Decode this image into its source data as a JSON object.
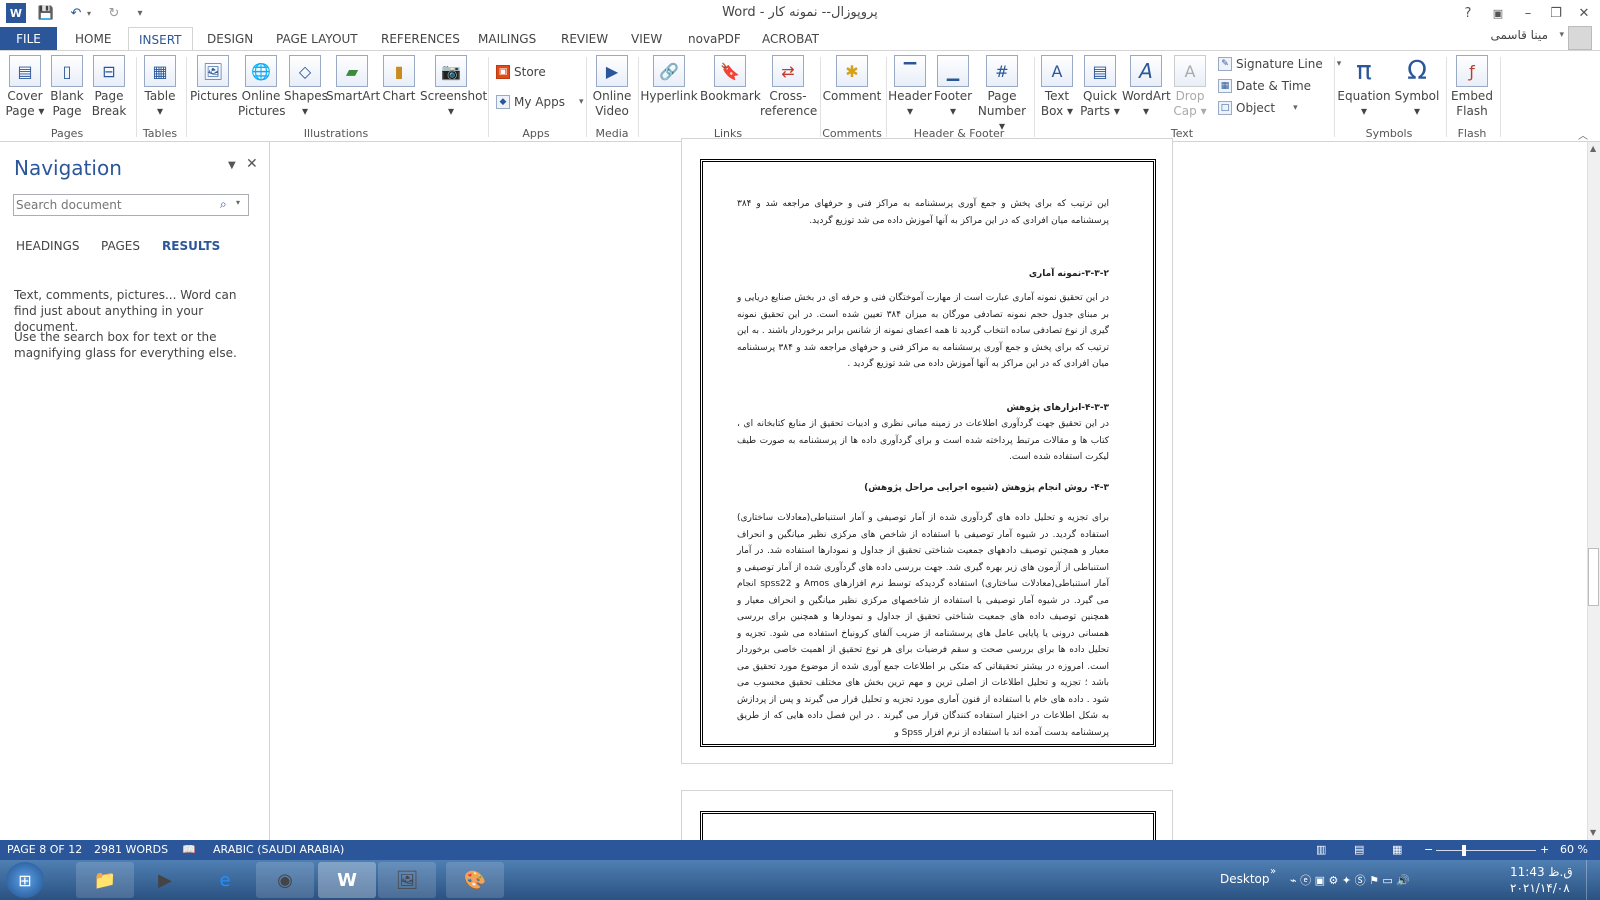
{
  "window": {
    "title": "پروپوزال-- نمونه کار - Word",
    "help": "?",
    "controls": [
      "–",
      "❐",
      "✕"
    ]
  },
  "tabs": [
    {
      "label": "FILE"
    },
    {
      "label": "HOME"
    },
    {
      "label": "INSERT"
    },
    {
      "label": "DESIGN"
    },
    {
      "label": "PAGE LAYOUT"
    },
    {
      "label": "REFERENCES"
    },
    {
      "label": "MAILINGS"
    },
    {
      "label": "REVIEW"
    },
    {
      "label": "VIEW"
    },
    {
      "label": "novaPDF"
    },
    {
      "label": "ACROBAT"
    }
  ],
  "user": {
    "name": "مینا قاسمی"
  },
  "ribbon": {
    "pages": {
      "label": "Pages",
      "cover": "Cover\nPage ▾",
      "blank": "Blank\nPage",
      "break": "Page\nBreak"
    },
    "tables": {
      "label": "Tables",
      "table": "Table\n▾"
    },
    "illustrations": {
      "label": "Illustrations",
      "pictures": "Pictures",
      "online": "Online\nPictures",
      "shapes": "Shapes\n▾",
      "smartart": "SmartArt",
      "chart": "Chart",
      "screenshot": "Screenshot\n▾"
    },
    "apps": {
      "label": "Apps",
      "store": "Store",
      "myapps": "My Apps"
    },
    "media": {
      "label": "Media",
      "video": "Online\nVideo"
    },
    "links": {
      "label": "Links",
      "hyperlink": "Hyperlink",
      "bookmark": "Bookmark",
      "crossref": "Cross-\nreference"
    },
    "comments": {
      "label": "Comments",
      "comment": "Comment"
    },
    "headerfooter": {
      "label": "Header & Footer",
      "header": "Header\n▾",
      "footer": "Footer\n▾",
      "pagenumber": "Page\nNumber ▾"
    },
    "text": {
      "label": "Text",
      "textbox": "Text\nBox ▾",
      "quickparts": "Quick\nParts ▾",
      "wordart": "WordArt\n▾",
      "dropcap": "Drop\nCap ▾",
      "sigline": "Signature Line",
      "datetime": "Date & Time",
      "object": "Object"
    },
    "symbols": {
      "label": "Symbols",
      "equation": "Equation\n▾",
      "symbol": "Symbol\n▾"
    },
    "flash": {
      "label": "Flash",
      "embed": "Embed\nFlash"
    }
  },
  "nav": {
    "title": "Navigation",
    "search_placeholder": "Search document",
    "tabs": [
      "HEADINGS",
      "PAGES",
      "RESULTS"
    ],
    "help1": "Text, comments, pictures... Word can find just about anything in your document.",
    "help2": "Use the search box for text or the magnifying glass for everything else."
  },
  "doc": {
    "p1": "این ترتیب که برای پخش و جمع آوری پرسشنامه به مراکز فنی و حرفهای مراجعه شد و ۳۸۴ پرسشنامه میان افرادی که در این مراکز به آنها آموزش داده می شد توزیع گردید.",
    "h2": "۳-۳-۲-نمونه آماری",
    "p2": "در این تحقیق نمونه آماری عبارت است از مهارت آموختگان فنی و حرفه ای در بخش صنایع دریایی و بر مبنای جدول حجم نمونه تصادفی مورگان به میزان ۳۸۴ تعیین شده است. در این تحقیق نمونه گیری از نوع تصادفی ساده انتخاب گردید تا همه اعضای نمونه از شانس برابر برخوردار باشند . به این ترتیب که برای پخش و جمع آوری پرسشنامه به مراکز فنی و حرفهای مراجعه شد و ۳۸۴ پرسشنامه میان افرادی که در این مراکز به آنها آموزش داده می شد توزیع گردید .",
    "h3": "۴-۳-۳-ابزارهای پژوهش",
    "p3": "در این تحقیق جهت گردآوری اطلاعات در زمینه مبانی نظری و ادبیات تحقیق از منابع کتابخانه ای ، کتاب ها و مقالات مرتبط پرداخته شده است و برای گردآوری داده ها از پرسشنامه به صورت طیف لیکرت استفاده شده است.",
    "h4": "۴-۳- روش انجام پژوهش (شیوه اجرایی مراحل پژوهش)",
    "p4": "برای تجزیه و تحلیل داده های گردآوری شده از آمار توصیفی و آمار استنباطی(معادلات ساختاری) استفاده گردید. در شیوه آمار توصیفی با استفاده از شاخص های مرکزی نظیر میانگین و انحراف معیار و همچنین توصیف دادههای جمعیت شناختی تحقیق از جداول و نمودارها استفاده شد. در آمار استنباطی از آزمون های زیر بهره گیری شد. جهت بررسی داده های گردآوری شده از آمار توصیفی و آمار استنباطی(معادلات ساختاری) استفاده گردیدکه توسط نرم افزارهای Amos و spss22 انجام می گیرد. در شیوه آمار توصیفی با استفاده از شاخصهای مرکزی نظیر میانگین و انحراف معیار و همچنین توصیف داده های جمعیت شناختی تحقیق از جداول و نمودارها و همچنین برای بررسی همسانی درونی یا پایایی عامل های پرسشنامه از ضریب آلفای کرونباخ استفاده می شود. تجزیه و تحلیل داده ها برای بررسی صحت و سقم فرضیات برای هر نوع تحقیق از اهمیت خاصی برخوردار است. امروزه در بیشتر تحقیقاتی که متکی بر اطلاعات جمع آوری شده از موضوع مورد تحقیق می باشد ؛ تجزیه و تحلیل اطلاعات از اصلی ترین و مهم ترین بخش های مختلف تحقیق محسوب می شود . داده های خام با استفاده از فنون آماری مورد تجزیه و تحلیل قرار می گیرند و پس از پردازش به شکل اطلاعات در اختیار استفاده کنندگان قرار می گیرند . در این فصل داده هایی که از طریق پرسشنامه بدست آمده اند با استفاده از نرم افزار Spss و"
  },
  "status": {
    "page": "PAGE 8 OF 12",
    "words": "2981 WORDS",
    "lang": "ARABIC (SAUDI ARABIA)",
    "zoom": "60 %"
  },
  "taskbar": {
    "desktop": "Desktop",
    "time": "11:43 ق.ظ",
    "date": "۲۰۲۱/۱۴/۰۸"
  },
  "colors": {
    "accent": "#2b579a",
    "taskbar": "#2a5282"
  }
}
